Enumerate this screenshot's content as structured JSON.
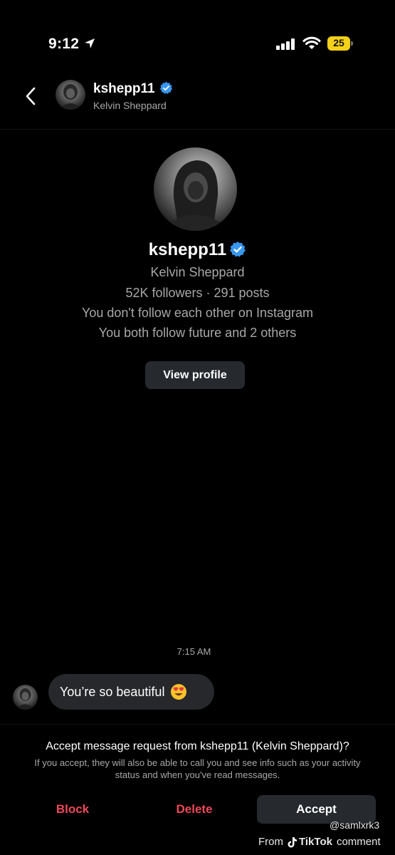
{
  "status_bar": {
    "time": "9:12",
    "battery_level": "25",
    "icons": [
      "location-arrow-icon",
      "signal-icon",
      "wifi-icon",
      "battery-icon"
    ],
    "battery_color": "#f5d019"
  },
  "header": {
    "username": "kshepp11",
    "full_name": "Kelvin Sheppard",
    "back_icon": "chevron-left-icon",
    "verified_icon": "verified-badge-icon"
  },
  "profile": {
    "username": "kshepp11",
    "full_name": "Kelvin Sheppard",
    "stats": "52K followers · 291 posts",
    "follow_status": "You don't follow each other on Instagram",
    "mutuals": "You both follow future and 2 others",
    "view_profile_label": "View profile"
  },
  "conversation": {
    "timestamp": "7:15 AM",
    "messages": [
      {
        "text": "You’re so beautiful",
        "emoji": "heart-eyes-emoji-icon"
      }
    ]
  },
  "request": {
    "title": "Accept message request from kshepp11 (Kelvin Sheppard)?",
    "description": "If you accept, they will also be able to call you and see info such as your activity status and when you've read messages.",
    "block_label": "Block",
    "delete_label": "Delete",
    "accept_label": "Accept"
  },
  "watermark": {
    "handle": "@samlxrk3",
    "from_label": "From",
    "brand": "TikTok",
    "suffix": "comment"
  },
  "colors": {
    "background": "#000000",
    "verified_blue": "#3897f0",
    "danger_red": "#ed4956",
    "button_gray": "#262a2f",
    "secondary_text": "#a8a8a8"
  }
}
